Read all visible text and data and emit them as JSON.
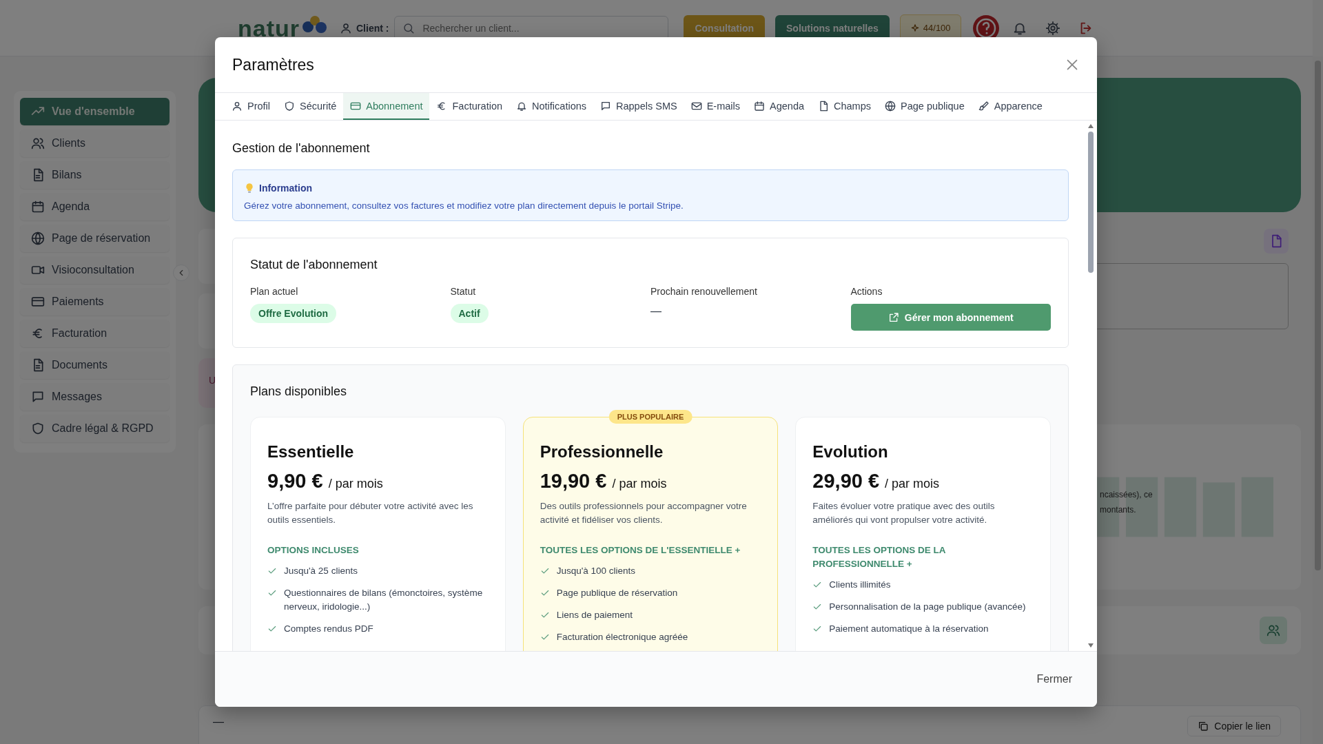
{
  "app": {
    "logo": "natur",
    "client_label": "Client :",
    "search_placeholder": "Rechercher un client...",
    "buttons": [
      {
        "label": "Consultation",
        "kind": "consultation"
      },
      {
        "label": "Solutions naturelles",
        "kind": "solutions"
      }
    ],
    "credits": "44/100"
  },
  "sidebar": {
    "items": [
      {
        "label": "Vue d'ensemble",
        "selected": true
      },
      {
        "label": "Clients",
        "selected": false
      },
      {
        "label": "Bilans",
        "selected": false
      },
      {
        "label": "Agenda",
        "selected": false
      },
      {
        "label": "Page de réservation",
        "selected": false
      },
      {
        "label": "Visioconsultation",
        "selected": false
      },
      {
        "label": "Paiements",
        "selected": false
      },
      {
        "label": "Facturation",
        "selected": false
      },
      {
        "label": "Documents",
        "selected": false
      },
      {
        "label": "Messages",
        "selected": false
      },
      {
        "label": "Cadre légal & RGPD",
        "selected": false
      }
    ]
  },
  "dashboard": {
    "alert": "U",
    "chart_text": [
      "ncaissées), ce",
      "montants."
    ],
    "bottom_value": "—",
    "copy_button": "Copier le lien"
  },
  "modal": {
    "title": "Paramètres",
    "tabs": [
      {
        "label": "Profil",
        "selected": false
      },
      {
        "label": "Sécurité",
        "selected": false
      },
      {
        "label": "Abonnement",
        "selected": true
      },
      {
        "label": "Facturation",
        "selected": false
      },
      {
        "label": "Notifications",
        "selected": false
      },
      {
        "label": "Rappels SMS",
        "selected": false
      },
      {
        "label": "E-mails",
        "selected": false
      },
      {
        "label": "Agenda",
        "selected": false
      },
      {
        "label": "Champs",
        "selected": false
      },
      {
        "label": "Page publique",
        "selected": false
      },
      {
        "label": "Apparence",
        "selected": false
      }
    ],
    "section_title": "Gestion de l'abonnement",
    "info": {
      "title": "Information",
      "text": "Gérez votre abonnement, consultez vos factures et modifiez votre plan directement depuis le portail Stripe."
    },
    "status": {
      "title": "Statut de l'abonnement",
      "columns": [
        {
          "label": "Plan actuel",
          "value": "Offre Evolution",
          "kind": "badge"
        },
        {
          "label": "Statut",
          "value": "Actif",
          "kind": "badge"
        },
        {
          "label": "Prochain renouvellement",
          "value": "—",
          "kind": "text"
        },
        {
          "label": "Actions",
          "value": "Gérer mon abonnement",
          "kind": "button"
        }
      ]
    },
    "plans": {
      "title": "Plans disponibles",
      "items": [
        {
          "name": "Essentielle",
          "price": "9,90 €",
          "period": "/ par mois",
          "description": "L’offre parfaite pour débuter votre activité avec les outils essentiels.",
          "options_title": "OPTIONS INCLUSES",
          "popular": false,
          "features": [
            "Jusqu'à 25 clients",
            "Questionnaires de bilans (émonctoires, système nerveux, iridologie...)",
            "Comptes rendus PDF"
          ]
        },
        {
          "name": "Professionnelle",
          "price": "19,90 €",
          "period": "/ par mois",
          "description": "Des outils professionnels pour accompagner votre activité et fidéliser vos clients.",
          "options_title": "TOUTES LES OPTIONS DE L'ESSENTIELLE +",
          "popular": true,
          "badge": "PLUS POPULAIRE",
          "features": [
            "Jusqu'à 100 clients",
            "Page publique de réservation",
            "Liens de paiement",
            "Facturation électronique agréée"
          ]
        },
        {
          "name": "Evolution",
          "price": "29,90 €",
          "period": "/ par mois",
          "description": "Faites évoluer votre pratique avec des outils améliorés qui vont propulser votre activité.",
          "options_title": "TOUTES LES OPTIONS DE LA PROFESSIONNELLE +",
          "popular": false,
          "features": [
            "Clients illimités",
            "Personnalisation de la page publique (avancée)",
            "Paiement automatique à la réservation"
          ]
        }
      ]
    },
    "close_label": "Fermer"
  }
}
